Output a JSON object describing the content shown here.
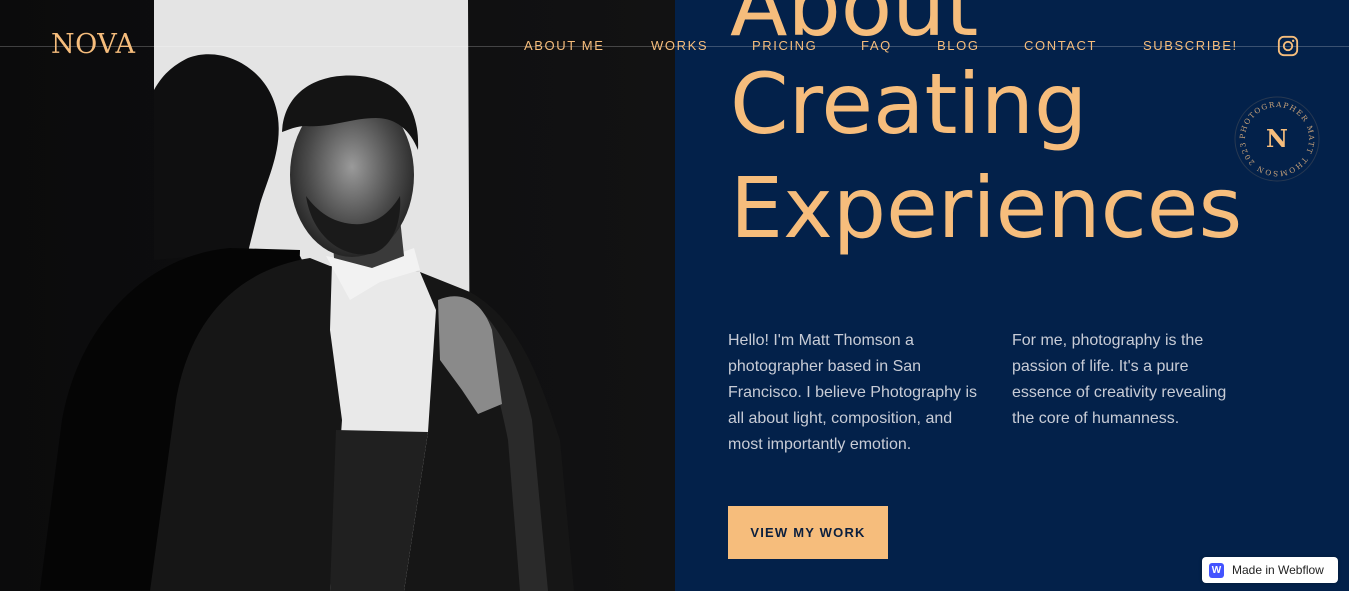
{
  "brand": {
    "logo": "NOVA",
    "colors": {
      "accent": "#f6bd7c",
      "navy": "#03214a",
      "photo_bg": "#0c0c0d"
    }
  },
  "nav": {
    "items": [
      {
        "label": "ABOUT ME"
      },
      {
        "label": "WORKS"
      },
      {
        "label": "PRICING"
      },
      {
        "label": "FAQ"
      },
      {
        "label": "BLOG"
      },
      {
        "label": "CONTACT"
      },
      {
        "label": "SUBSCRIBE!"
      }
    ],
    "social_icon": "instagram-icon"
  },
  "hero": {
    "headline_line1": "About",
    "headline_line2": "Creating",
    "headline_line3": "Experiences",
    "paragraph_left": "Hello! I'm Matt Thomson a photographer based in San Francisco. I believe Photography is all about light, composition, and most importantly emotion.",
    "paragraph_right": "For me, photography is the passion of life. It's a pure essence of creativity revealing the core of humanness.",
    "cta_label": "VIEW MY WORK"
  },
  "badge": {
    "letter": "N",
    "ring_text": "PHOTOGRAPHER MATT THOMSON 2023"
  },
  "webflow_badge": {
    "label": "Made in Webflow",
    "icon": "webflow-logo-icon",
    "logo_letter": "W"
  }
}
